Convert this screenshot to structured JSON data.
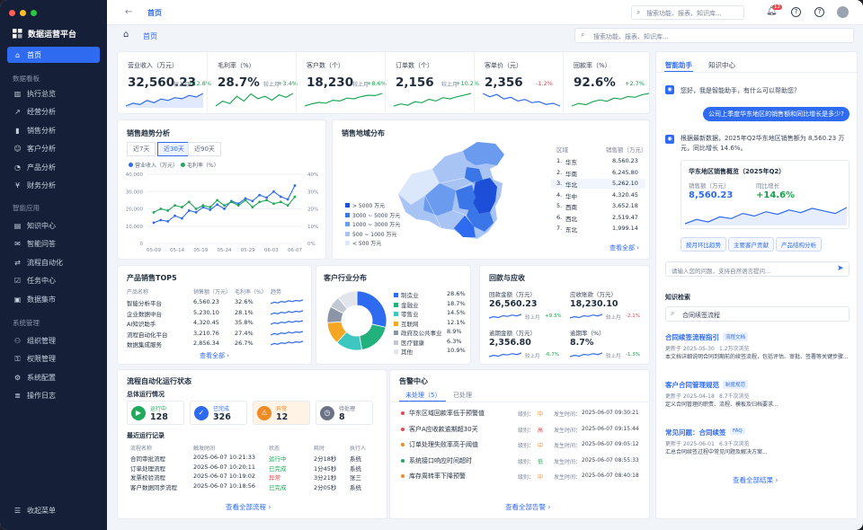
{
  "app": {
    "title": "数据运营平台"
  },
  "sidebar": {
    "home": "首页",
    "sec1": "数据看板",
    "board": [
      "执行总览",
      "经营分析",
      "销售分析",
      "客户分析",
      "产品分析",
      "财务分析"
    ],
    "sec2": "智能应用",
    "apps": [
      "知识中心",
      "智能问答",
      "流程自动化",
      "任务中心",
      "数据集市"
    ],
    "sec3": "系统管理",
    "sys": [
      "组织管理",
      "权限管理",
      "系统配置",
      "操作日志"
    ],
    "collapse": "收起菜单"
  },
  "topbar": {
    "tab": "首页",
    "search_placeholder": "搜索功能、报表、知识库...",
    "notif_count": "12"
  },
  "breadcrumb": {
    "home": "首页",
    "search_placeholder": "搜索功能、报表、知识库..."
  },
  "kpis": [
    {
      "label": "营业收入（万元）",
      "value": "32,560.23",
      "cmp": "较上月",
      "delta": "+12.8%",
      "up": true,
      "spark": [
        3,
        4,
        3.5,
        5,
        4.2,
        5.5,
        5,
        6,
        5.6,
        6.8,
        6.2,
        7.5
      ]
    },
    {
      "label": "毛利率（%）",
      "value": "28.7%",
      "cmp": "较上月",
      "delta": "+3.4%",
      "up": true,
      "spark": [
        4,
        5,
        4.5,
        6,
        5,
        6.5,
        5.5,
        6,
        5.2,
        6.3,
        5.8,
        6.6
      ]
    },
    {
      "label": "客户数（个）",
      "value": "18,230",
      "cmp": "较上月",
      "delta": "+8.6%",
      "up": true,
      "spark": [
        3,
        3.6,
        4,
        3.8,
        4.6,
        4.4,
        5.2,
        5,
        5.6,
        6,
        5.9,
        6.5
      ]
    },
    {
      "label": "订单数（个）",
      "value": "2,156",
      "cmp": "较上月",
      "delta": "+10.2%",
      "up": true,
      "spark": [
        4,
        4.5,
        4.2,
        5,
        4.8,
        5.6,
        5.2,
        6,
        5.7,
        6.2,
        6.6,
        7
      ]
    },
    {
      "label": "客单价（元）",
      "value": "2,356",
      "cmp": "",
      "delta": "-1.2%",
      "up": false,
      "spark": [
        6,
        5.4,
        5.8,
        5,
        5.3,
        4.6,
        4.9,
        4.3,
        4.5,
        4,
        4.2,
        3.7
      ]
    },
    {
      "label": "回款率（%）",
      "value": "92.6%",
      "cmp": "",
      "delta": "+2.7%",
      "up": true,
      "spark": [
        4,
        4.6,
        4.3,
        5,
        5.4,
        5.1,
        5.8,
        5.6,
        6.2,
        6,
        6.6,
        6.9
      ]
    }
  ],
  "sales_trend": {
    "title": "销售趋势分析",
    "tabs": [
      "近7天",
      "近30天",
      "近90天"
    ],
    "active_tab": 1,
    "legend": [
      "营业收入（万元）",
      "毛利率（%）"
    ],
    "colors": [
      "#2f6bf0",
      "#22a85a"
    ],
    "chart_data": {
      "type": "line",
      "x": [
        "05-09",
        "05-14",
        "05-19",
        "05-24",
        "05-29",
        "06-03",
        "06-07"
      ],
      "ylim": [
        0,
        40000
      ],
      "y2lim": [
        0,
        40
      ],
      "yticks": [
        "40,000",
        "30,000",
        "20,000",
        "10,000",
        "0"
      ],
      "y2ticks": [
        "40%",
        "30%",
        "20%",
        "10%",
        "0%"
      ],
      "series": [
        {
          "name": "营业收入（万元）",
          "values": [
            12000,
            13500,
            12800,
            16000,
            14500,
            19000,
            18000,
            21000,
            19500,
            22500,
            20000,
            24500,
            23000,
            26000,
            24500,
            28000,
            26500,
            30000,
            27000,
            25500,
            33500
          ]
        },
        {
          "name": "毛利率（%）",
          "values": [
            18,
            20,
            19,
            22,
            21,
            24,
            20,
            22,
            21,
            25,
            22,
            24,
            22,
            25,
            21,
            24,
            25,
            23,
            24,
            22,
            27
          ]
        }
      ]
    }
  },
  "geo": {
    "title": "销售地域分布",
    "legend": [
      "> 5000 万元",
      "3000 ~ 5000 万元",
      "1000 ~ 3000 万元",
      "500 ~ 1000 万元",
      "< 500 万元"
    ],
    "legend_colors": [
      "#1d4ed8",
      "#3b76e8",
      "#6b9bef",
      "#a8c4f5",
      "#dbe7fb"
    ],
    "head_region": "区域",
    "head_amount": "销售额（万元）",
    "rows": [
      {
        "rank": "1.",
        "region": "华东",
        "amount": "8,560.23"
      },
      {
        "rank": "2.",
        "region": "华南",
        "amount": "6,245.80"
      },
      {
        "rank": "3.",
        "region": "华北",
        "amount": "5,262.10"
      },
      {
        "rank": "4.",
        "region": "华中",
        "amount": "4,320.45"
      },
      {
        "rank": "5.",
        "region": "西南",
        "amount": "3,652.18"
      },
      {
        "rank": "6.",
        "region": "西北",
        "amount": "2,519.47"
      },
      {
        "rank": "7.",
        "region": "东北",
        "amount": "1,999.14"
      }
    ],
    "view_all": "查看全部"
  },
  "products": {
    "title": "产品销售TOP5",
    "head": [
      "产品名称",
      "销售额（万元）",
      "毛利率（%）",
      "趋势"
    ],
    "rows": [
      {
        "name": "智能分析平台",
        "sales": "6,560.23",
        "margin": "32.6%"
      },
      {
        "name": "企业数据中台",
        "sales": "5,230.10",
        "margin": "28.1%"
      },
      {
        "name": "AI知识助手",
        "sales": "4,320.45",
        "margin": "35.8%"
      },
      {
        "name": "流程自动化平台",
        "sales": "3,210.76",
        "margin": "27.4%"
      },
      {
        "name": "数据集成服务",
        "sales": "2,856.34",
        "margin": "26.7%"
      }
    ],
    "view_all": "查看全部"
  },
  "industry": {
    "title": "客户行业分布",
    "chart_data": {
      "type": "pie",
      "categories": [
        "制造业",
        "金融业",
        "零售业",
        "互联网",
        "政府及公共事业",
        "医疗健康",
        "其他"
      ],
      "values": [
        28.6,
        18.7,
        14.5,
        12.1,
        8.9,
        6.3,
        10.9
      ],
      "labels": [
        "28.6%",
        "18.7%",
        "14.5%",
        "12.1%",
        "8.9%",
        "6.3%",
        "10.9%"
      ],
      "colors": [
        "#2f6bf0",
        "#22b07d",
        "#3ec7c0",
        "#f5a623",
        "#8b95a7",
        "#c2c8d2",
        "#e2e6ec"
      ]
    }
  },
  "receivable": {
    "title": "回款与应收",
    "items": [
      {
        "label": "回款金额（万元）",
        "value": "26,560.23",
        "cmp": "较上月",
        "delta": "+9.3%",
        "up": true
      },
      {
        "label": "应收账款（万元）",
        "value": "18,230.10",
        "cmp": "较上月",
        "delta": "-2.1%",
        "up": false
      },
      {
        "label": "逾期金额（万元）",
        "value": "2,356.80",
        "cmp": "较上月",
        "delta": "-6.7%",
        "up": true
      },
      {
        "label": "逾期率（%）",
        "value": "8.7%",
        "cmp": "较上月",
        "delta": "-1.3%",
        "up": true
      }
    ]
  },
  "automation": {
    "title": "流程自动化运行状态",
    "subtitle": "总体运行情况",
    "stats": [
      {
        "label": "运行中",
        "value": "128",
        "color": "#22a85a",
        "bg": "#e9f7ef"
      },
      {
        "label": "已完成",
        "value": "326",
        "color": "#2f6bf0",
        "bg": "#eef3fe"
      },
      {
        "label": "异常",
        "value": "12",
        "color": "#f08a24",
        "bg": "#fff3e6"
      },
      {
        "label": "待处理",
        "value": "8",
        "color": "#6b7486",
        "bg": "#f2f4f7"
      }
    ],
    "recent_title": "最近运行记录",
    "head": [
      "流程名称",
      "触发时间",
      "状态",
      "耗时",
      "执行人"
    ],
    "rows": [
      {
        "name": "合同审批流程",
        "time": "2025-06-07 10:21:33",
        "status": "运行中",
        "cost": "2分18秒",
        "by": "系统",
        "color": "#22a85a"
      },
      {
        "name": "订单处理流程",
        "time": "2025-06-07 10:20:11",
        "status": "已完成",
        "cost": "1分45秒",
        "by": "系统",
        "color": "#22a85a"
      },
      {
        "name": "发票校验流程",
        "time": "2025-06-07 10:19:02",
        "status": "异常",
        "cost": "3分21秒",
        "by": "张三",
        "color": "#e5484d"
      },
      {
        "name": "客户数据同步流程",
        "time": "2025-06-07 10:18:56",
        "status": "已完成",
        "cost": "2分05秒",
        "by": "系统",
        "color": "#22a85a"
      }
    ],
    "view_all": "查看全部流程"
  },
  "alerts": {
    "title": "告警中心",
    "tab_open": "未处理（5）",
    "tab_done": "已处理",
    "level_label": "级别：",
    "time_label": "发生时间：",
    "rows": [
      {
        "text": "华东区域回款率低于预警值",
        "level": "中",
        "time": "2025-06-07 09:30:21",
        "color": "#e5484d",
        "lcolor": "#f08a24"
      },
      {
        "text": "客户A应收款逾期超30天",
        "level": "高",
        "time": "2025-06-07 09:15:44",
        "color": "#e5484d",
        "lcolor": "#e5484d"
      },
      {
        "text": "订单处理失败率高于阈值",
        "level": "中",
        "time": "2025-06-07 09:05:12",
        "color": "#f08a24",
        "lcolor": "#f08a24"
      },
      {
        "text": "系统接口响应时间超时",
        "level": "低",
        "time": "2025-06-07 08:55:33",
        "color": "#22a85a",
        "lcolor": "#22a85a"
      },
      {
        "text": "库存周转率下降预警",
        "level": "中",
        "time": "2025-06-07 08:40:18",
        "color": "#f08a24",
        "lcolor": "#f08a24"
      }
    ],
    "view_all": "查看全部告警"
  },
  "assistant": {
    "tab_ai": "智能助手",
    "tab_kb": "知识中心",
    "greeting": "您好，我是智能助手，有什么可以帮助您？",
    "question": "公司上季度华东地区的销售额和同比增长是多少?",
    "answer": "根据最新数据，2025年Q2华东地区销售额为 8,560.23 万元，同比增长 14.6%。",
    "card_title": "华东地区销售概览（2025年Q2）",
    "sales_label": "销售额（万元）",
    "sales_value": "8,560.23",
    "yoy_label": "同比增长",
    "yoy_value": "+14.6%",
    "card_spark": [
      3,
      3.5,
      3.2,
      3.8,
      3.6,
      4.2,
      3.9,
      4.4,
      4.1,
      4.6,
      4.3,
      4.8,
      4.5,
      4.2,
      4.9
    ],
    "chips": [
      "按月环比趋势",
      "主要客户贡献",
      "产品结构分析"
    ],
    "input_placeholder": "请输入您的问题，支持自然语言提问...",
    "kb_title": "知识检索",
    "kb_search": "合同续签流程",
    "docs": [
      {
        "title": "合同续签流程指引",
        "tag": "流程文档",
        "date": "更新于 2025-05-30",
        "views": "1.2万次浏览",
        "desc": "本文档详细说明合同到期前的续签流程，包括评估、审批、签署等关键步骤..."
      },
      {
        "title": "客户合同管理规范",
        "tag": "制度规范",
        "date": "更新于 2025-04-18",
        "views": "8.7千次浏览",
        "desc": "定义合同管理的职责、流程、模板及归档要求..."
      },
      {
        "title": "常见问题：合同续签",
        "tag": "FAQ",
        "date": "更新于 2025-06-01",
        "views": "6.3千次浏览",
        "desc": "汇总合同续签过程中常见问题及解决方案..."
      }
    ],
    "view_all": "查看全部结果"
  }
}
